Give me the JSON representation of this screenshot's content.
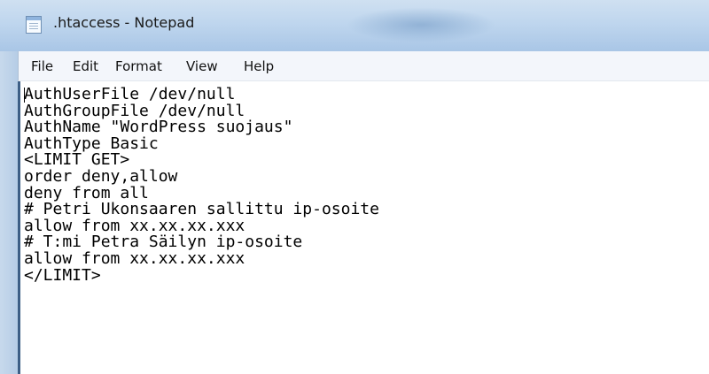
{
  "window": {
    "title": ".htaccess - Notepad",
    "icon": "notepad-icon"
  },
  "menu": {
    "items": [
      {
        "label": "File"
      },
      {
        "label": "Edit"
      },
      {
        "label": "Format"
      },
      {
        "label": "View"
      },
      {
        "label": "Help"
      }
    ]
  },
  "editor": {
    "lines": [
      "AuthUserFile /dev/null",
      "AuthGroupFile /dev/null",
      "AuthName \"WordPress suojaus\"",
      "AuthType Basic",
      "<LIMIT GET>",
      "order deny,allow",
      "deny from all",
      "# Petri Ukonsaaren sallittu ip-osoite",
      "allow from xx.xx.xx.xxx",
      "# T:mi Petra Säilyn ip-osoite",
      "allow from xx.xx.xx.xxx",
      "</LIMIT>"
    ]
  },
  "colors": {
    "titlebar": "#bfd6ee",
    "menubar": "#f3f6fb",
    "editor_border": "#3d5f86"
  }
}
